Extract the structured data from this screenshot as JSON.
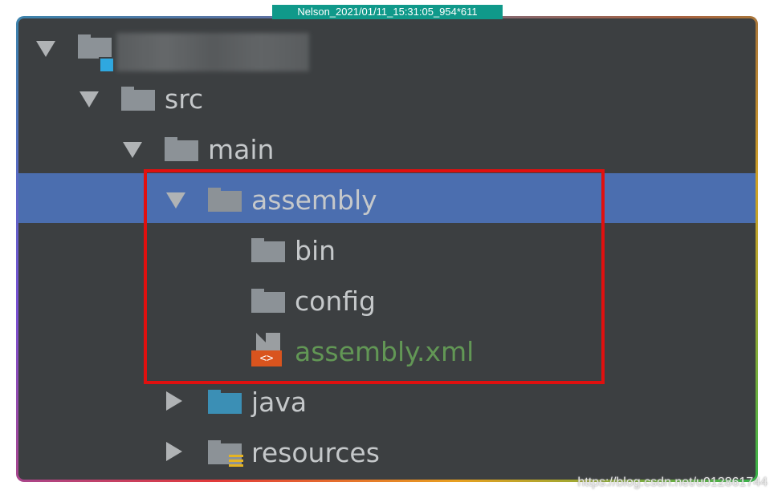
{
  "capture_label": "Nelson_2021/01/11_15:31:05_954*611",
  "tree": {
    "items": [
      {
        "label": "",
        "icon": "module-folder-icon"
      },
      {
        "label": "src",
        "icon": "folder-icon"
      },
      {
        "label": "main",
        "icon": "folder-icon"
      },
      {
        "label": "assembly",
        "icon": "folder-icon",
        "selected": true
      },
      {
        "label": "bin",
        "icon": "folder-icon"
      },
      {
        "label": "config",
        "icon": "folder-icon"
      },
      {
        "label": "assembly.xml",
        "icon": "xml-file-icon",
        "icon_text": "<>"
      },
      {
        "label": "java",
        "icon": "source-folder-icon"
      },
      {
        "label": "resources",
        "icon": "resources-folder-icon"
      }
    ]
  },
  "watermark": "https://blog.csdn.net/u012861744",
  "colors": {
    "background": "#3c3f41",
    "selection": "#4b6eaf",
    "highlight_border": "#e0100f",
    "xml_file_text": "#629755",
    "source_folder": "#3b8fb5"
  }
}
